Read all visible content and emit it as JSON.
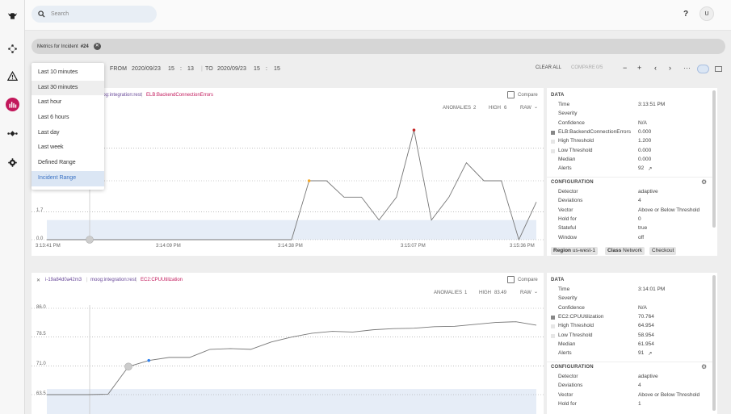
{
  "search": {
    "placeholder": "Search"
  },
  "header": {
    "help": "?",
    "user_initial": "U"
  },
  "incident_chip": {
    "label": "Metrics for Incident",
    "number": "#24"
  },
  "timebar": {
    "from_label": "FROM",
    "from_date": "2020/09/23",
    "from_hour": "15",
    "from_min": "13",
    "to_label": "TO",
    "to_date": "2020/09/23",
    "to_hour": "15",
    "to_min": "15",
    "clear_all": "CLEAR ALL",
    "compare": "COMPARE",
    "compare_count": "0/5"
  },
  "dropdown": {
    "items": [
      "Last 10 minutes",
      "Last 30 minutes",
      "Last hour",
      "Last 6 hours",
      "Last day",
      "Last week",
      "Defined Range",
      "Incident Range"
    ]
  },
  "panel1": {
    "source": "moog:integration:rest",
    "metric": "ELB:BackendConnectionErrors",
    "compare_label": "Compare",
    "anomalies_label": "ANOMALIES",
    "anomalies": "2",
    "high_label": "HIGH",
    "high": "6",
    "mode": "RAW",
    "y_labels": [
      "1.7",
      "0.0"
    ],
    "x_labels": [
      "3:13:41 PM",
      "3:14:09 PM",
      "3:14:38 PM",
      "3:15:07 PM",
      "3:15:36 PM"
    ],
    "series": [
      0,
      0,
      0,
      0,
      0,
      0,
      0,
      0,
      0,
      0,
      0,
      0,
      0,
      0,
      0,
      3.6,
      3.6,
      2.6,
      2.6,
      1.2,
      2.6,
      6.7,
      1.2,
      2.6,
      4.7,
      3.6,
      3.6,
      0,
      2.3
    ]
  },
  "panel1_side": {
    "data_title": "DATA",
    "rows": [
      {
        "k": "Time",
        "v": "3:13:51 PM"
      },
      {
        "k": "Severity",
        "v": ""
      },
      {
        "k": "Confidence",
        "v": "N/A"
      },
      {
        "k": "ELB:BackendConnectionErrors",
        "v": "0.000"
      },
      {
        "k": "High Threshold",
        "v": "1.200"
      },
      {
        "k": "Low Threshold",
        "v": "0.000"
      },
      {
        "k": "Median",
        "v": "0.000"
      },
      {
        "k": "Alerts",
        "v": "92"
      }
    ],
    "config_title": "CONFIGURATION",
    "config": [
      {
        "k": "Detector",
        "v": "adaptive"
      },
      {
        "k": "Deviations",
        "v": "4"
      },
      {
        "k": "Vector",
        "v": "Above or Below Threshold"
      },
      {
        "k": "Hold for",
        "v": "0"
      },
      {
        "k": "Stateful",
        "v": "true"
      },
      {
        "k": "Window",
        "v": "off"
      }
    ],
    "tags": [
      {
        "k": "Region",
        "v": "us-west-1"
      },
      {
        "k": "Class",
        "v": "Network"
      },
      {
        "k": "",
        "v": "Checkout"
      }
    ]
  },
  "panel2": {
    "host": "i-19a84d0a42m3",
    "source": "moog:integration:rest",
    "metric": "EC2:CPUUtilization",
    "compare_label": "Compare",
    "anomalies_label": "ANOMALIES",
    "anomalies": "1",
    "high_label": "HIGH",
    "high": "83.49",
    "mode": "RAW",
    "y_labels": [
      "86.0",
      "78.5",
      "71.0",
      "63.5"
    ],
    "series": [
      63.5,
      63.5,
      63.5,
      63.6,
      70.8,
      72.4,
      73.2,
      73.2,
      75.3,
      75.5,
      75.3,
      77.2,
      78.5,
      79.5,
      80.0,
      79.8,
      80.4,
      80.7,
      80.8,
      81.2,
      81.3,
      81.8,
      82.3,
      82.5,
      81.6
    ]
  },
  "panel2_side": {
    "data_title": "DATA",
    "rows": [
      {
        "k": "Time",
        "v": "3:14:01 PM"
      },
      {
        "k": "Severity",
        "v": ""
      },
      {
        "k": "Confidence",
        "v": "N/A"
      },
      {
        "k": "EC2:CPUUtilization",
        "v": "70.764"
      },
      {
        "k": "High Threshold",
        "v": "64.954"
      },
      {
        "k": "Low Threshold",
        "v": "58.954"
      },
      {
        "k": "Median",
        "v": "61.954"
      },
      {
        "k": "Alerts",
        "v": "91"
      }
    ],
    "config_title": "CONFIGURATION",
    "config": [
      {
        "k": "Detector",
        "v": "adaptive"
      },
      {
        "k": "Deviations",
        "v": "4"
      },
      {
        "k": "Vector",
        "v": "Above or Below Threshold"
      },
      {
        "k": "Hold for",
        "v": "1"
      }
    ]
  },
  "colors": {
    "accent": "#c2185b",
    "link": "#3a72c4",
    "band": "#e6edf7",
    "anomaly": "#c62828",
    "marker_orange": "#f5a623",
    "marker_blue": "#2f80ed"
  }
}
